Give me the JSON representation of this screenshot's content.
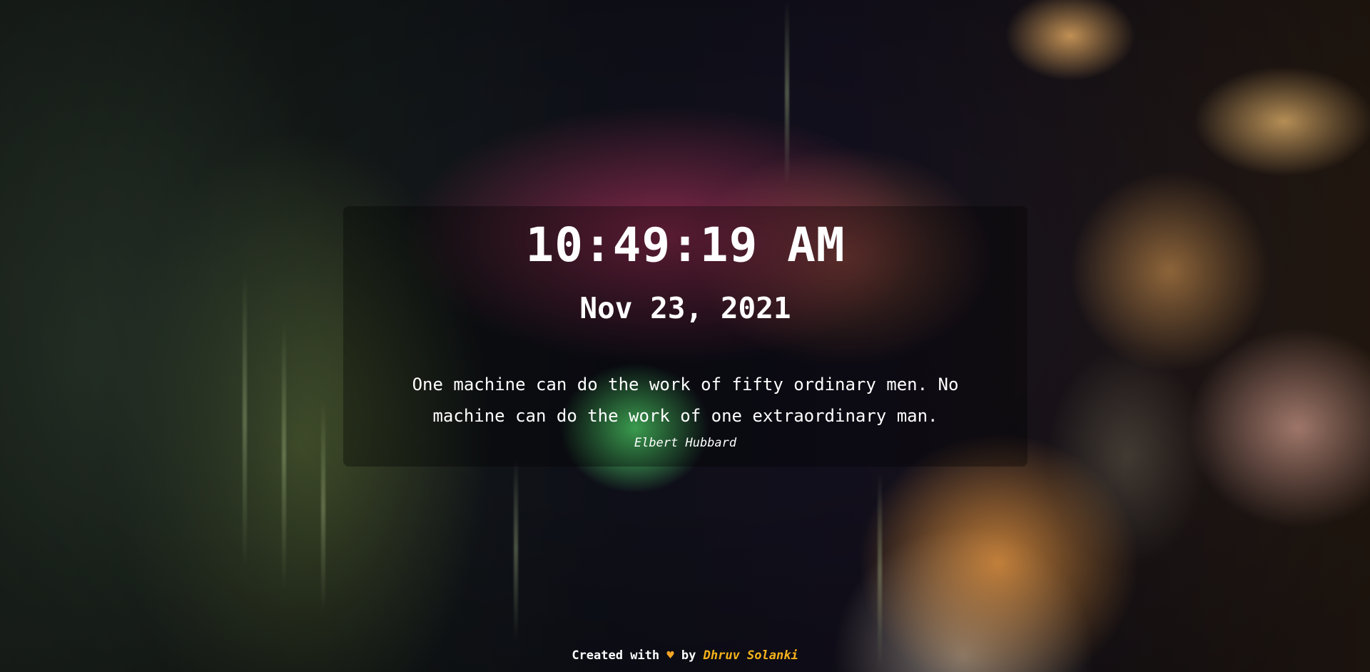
{
  "clock": {
    "time": "10:49:19 AM",
    "date": "Nov 23, 2021"
  },
  "quote": {
    "text": "One machine can do the work of fifty ordinary men. No machine can do the work of one extraordinary man.",
    "author": "Elbert Hubbard"
  },
  "footer": {
    "prefix": "Created with",
    "heart_icon": "♥",
    "by": "by",
    "creator": "Dhruv Solanki"
  },
  "colors": {
    "accent": "#f5b21a",
    "text": "#ffffff"
  }
}
